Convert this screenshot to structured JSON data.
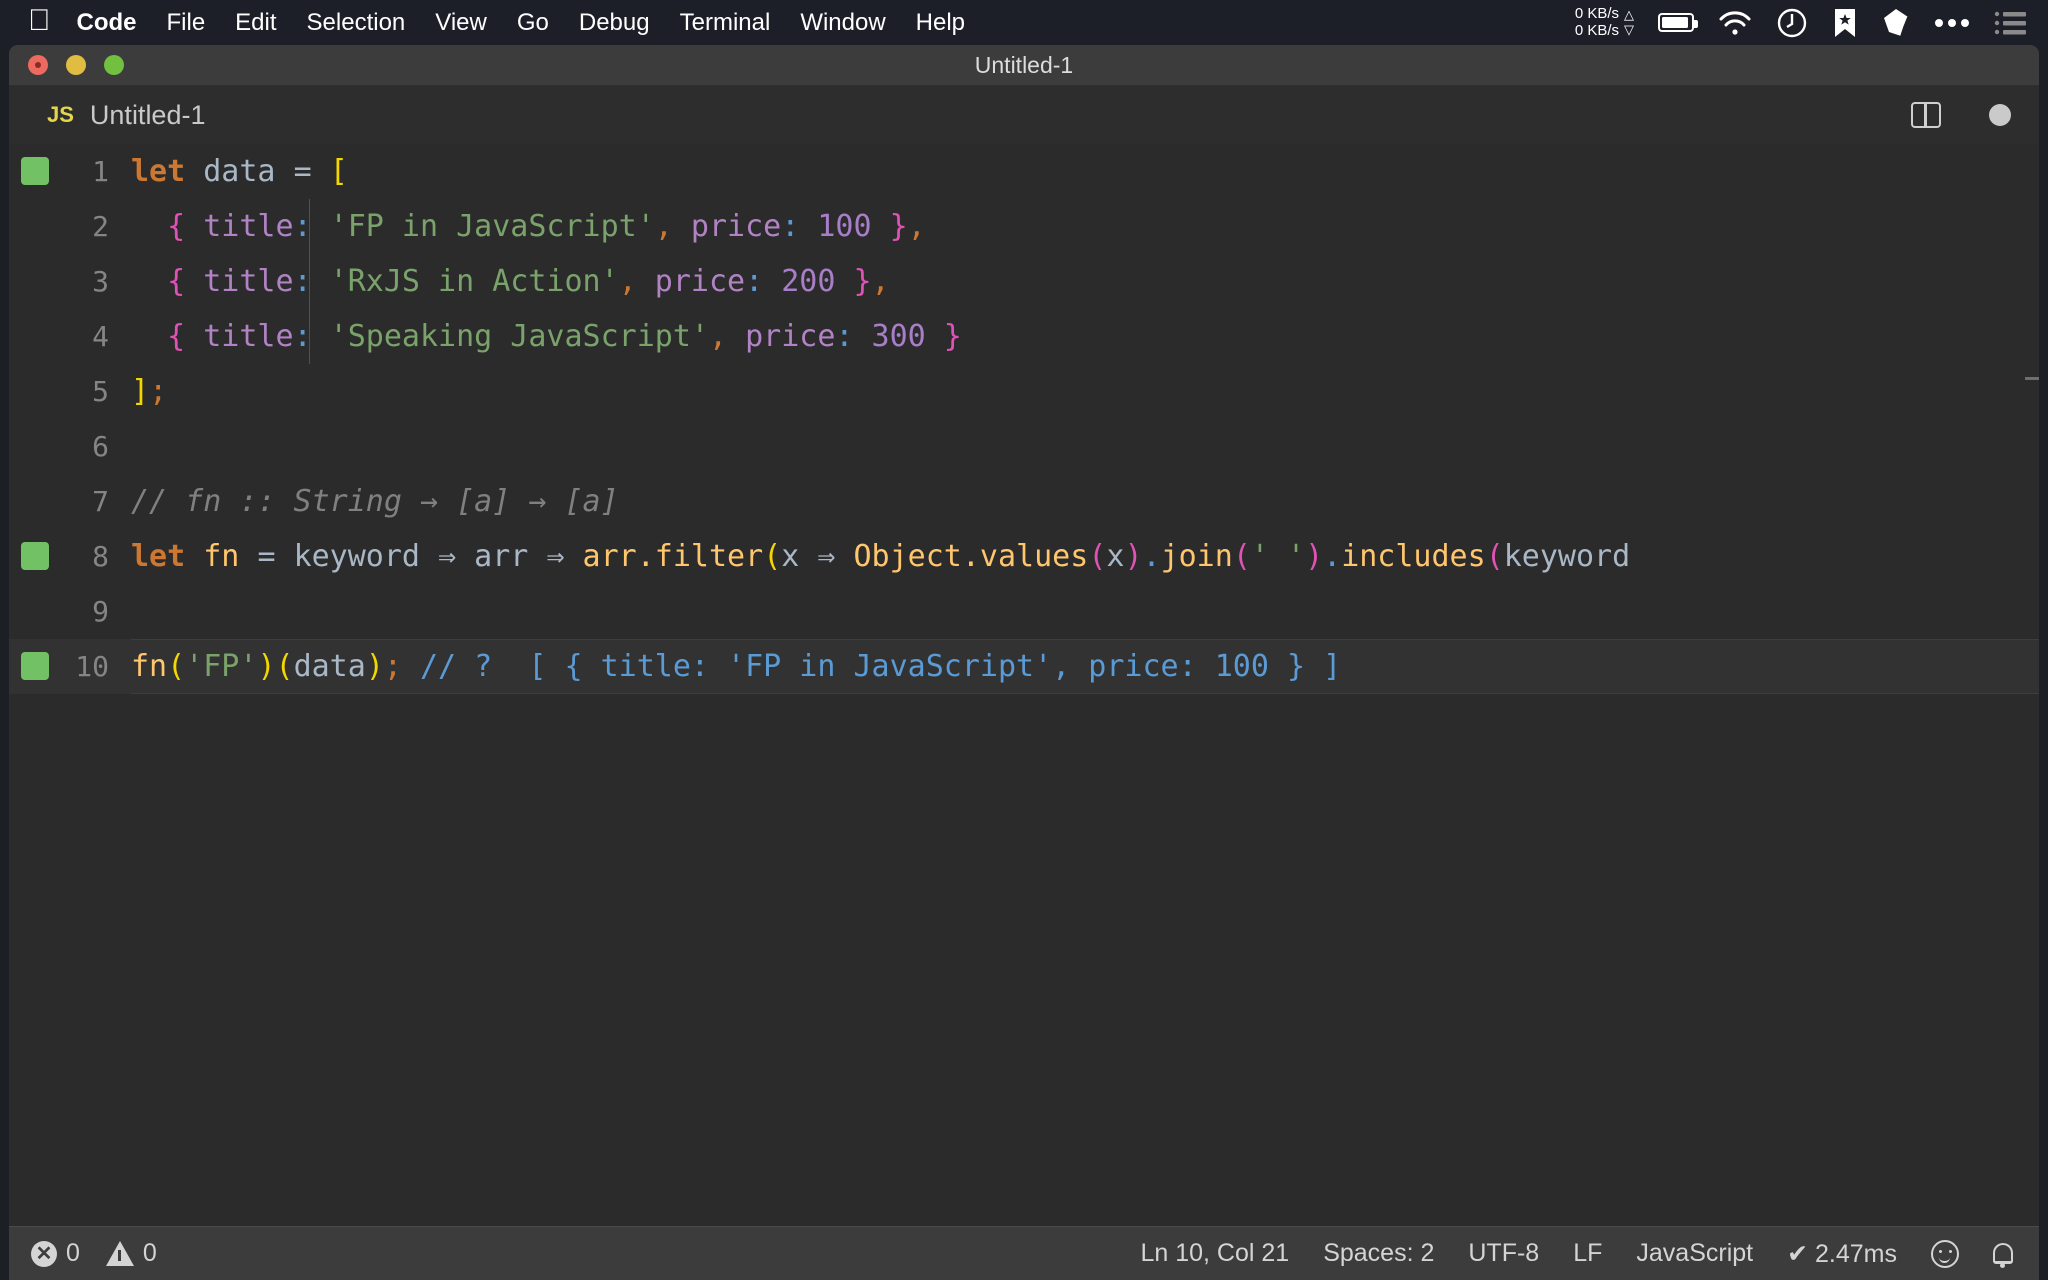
{
  "menubar": {
    "apple_glyph": "apple-logo",
    "items": [
      {
        "label": "Code",
        "bold": true
      },
      {
        "label": "File",
        "bold": false
      },
      {
        "label": "Edit",
        "bold": false
      },
      {
        "label": "Selection",
        "bold": false
      },
      {
        "label": "View",
        "bold": false
      },
      {
        "label": "Go",
        "bold": false
      },
      {
        "label": "Debug",
        "bold": false
      },
      {
        "label": "Terminal",
        "bold": false
      },
      {
        "label": "Window",
        "bold": false
      },
      {
        "label": "Help",
        "bold": false
      }
    ],
    "network": {
      "up": "0 KB/s",
      "down": "0 KB/s",
      "up_arrow": "△",
      "down_arrow": "▽"
    },
    "icons": [
      "battery-icon",
      "wifi-icon",
      "timer-icon",
      "bookmark-star-icon",
      "gem-icon",
      "ellipsis-icon",
      "list-icon"
    ]
  },
  "window": {
    "title": "Untitled-1",
    "traffic_lights": [
      "close-button",
      "minimize-button",
      "zoom-button"
    ]
  },
  "tab": {
    "badge": "JS",
    "label": "Untitled-1",
    "split_icon": "split-editor-icon",
    "dirty_icon": "unsaved-dot-icon"
  },
  "editor": {
    "lines": [
      {
        "no": "1",
        "mark": true,
        "current": false,
        "indent": false
      },
      {
        "no": "2",
        "mark": false,
        "current": false,
        "indent": true
      },
      {
        "no": "3",
        "mark": false,
        "current": false,
        "indent": true
      },
      {
        "no": "4",
        "mark": false,
        "current": false,
        "indent": true
      },
      {
        "no": "5",
        "mark": false,
        "current": false,
        "indent": false
      },
      {
        "no": "6",
        "mark": false,
        "current": false,
        "indent": false
      },
      {
        "no": "7",
        "mark": false,
        "current": false,
        "indent": false
      },
      {
        "no": "8",
        "mark": true,
        "current": false,
        "indent": false
      },
      {
        "no": "9",
        "mark": false,
        "current": false,
        "indent": false
      },
      {
        "no": "10",
        "mark": true,
        "current": true,
        "indent": false
      }
    ],
    "code": {
      "l1_let": "let",
      "l1_data": " data ",
      "l1_eq": "= ",
      "l1_br": "[",
      "l2_indent": "  ",
      "l2_brace": "{",
      "l2_title": " title",
      "l2_colon": ":",
      "l2_str": " 'FP in JavaScript'",
      "l2_comma": ",",
      "l2_price": " price",
      "l2_colon2": ":",
      "l2_num": " 100",
      "l2_brace2": " }",
      "l2_comma2": ",",
      "l3_indent": "  ",
      "l3_brace": "{",
      "l3_title": " title",
      "l3_colon": ":",
      "l3_str": " 'RxJS in Action'",
      "l3_comma": ",",
      "l3_price": " price",
      "l3_colon2": ":",
      "l3_num": " 200",
      "l3_brace2": " }",
      "l3_comma2": ",",
      "l4_indent": "  ",
      "l4_brace": "{",
      "l4_title": " title",
      "l4_colon": ":",
      "l4_str": " 'Speaking JavaScript'",
      "l4_comma": ",",
      "l4_price": " price",
      "l4_colon2": ":",
      "l4_num": " 300",
      "l4_brace2": " }",
      "l5_br": "]",
      "l5_semi": ";",
      "l7_comment": "// fn :: String → [a] → [a]",
      "l8_let": "let",
      "l8_fn": " fn ",
      "l8_eq": "= ",
      "l8_keyword": "keyword ",
      "l8_arrow1": "⇒",
      "l8_arr": " arr ",
      "l8_arrow2": "⇒",
      "l8_arrfilter": " arr.filter",
      "l8_p1": "(",
      "l8_x": "x ",
      "l8_arrow3": "⇒",
      "l8_object": " Object.values",
      "l8_p2": "(",
      "l8_x2": "x",
      "l8_p3": ")",
      "l8_dot": ".",
      "l8_join": "join",
      "l8_p4": "(",
      "l8_strsp": "' '",
      "l8_p5": ")",
      "l8_dot2": ".",
      "l8_includes": "includes",
      "l8_p6": "(",
      "l8_kw2": "keyword",
      "l10_fn": "fn",
      "l10_p1": "(",
      "l10_str": "'FP'",
      "l10_p2": ")",
      "l10_p3": "(",
      "l10_data": "data",
      "l10_p4": ")",
      "l10_semi": ";",
      "l10_result": " // ?  [ { title: 'FP in JavaScript', price: 100 } ]"
    }
  },
  "statusbar": {
    "errors": "0",
    "warnings": "0",
    "position": "Ln 10, Col 21",
    "indentation": "Spaces: 2",
    "encoding": "UTF-8",
    "eol": "LF",
    "language": "JavaScript",
    "runtime": "✔ 2.47ms",
    "feedback_icon": "smiley-icon",
    "notifications_icon": "bell-icon"
  }
}
